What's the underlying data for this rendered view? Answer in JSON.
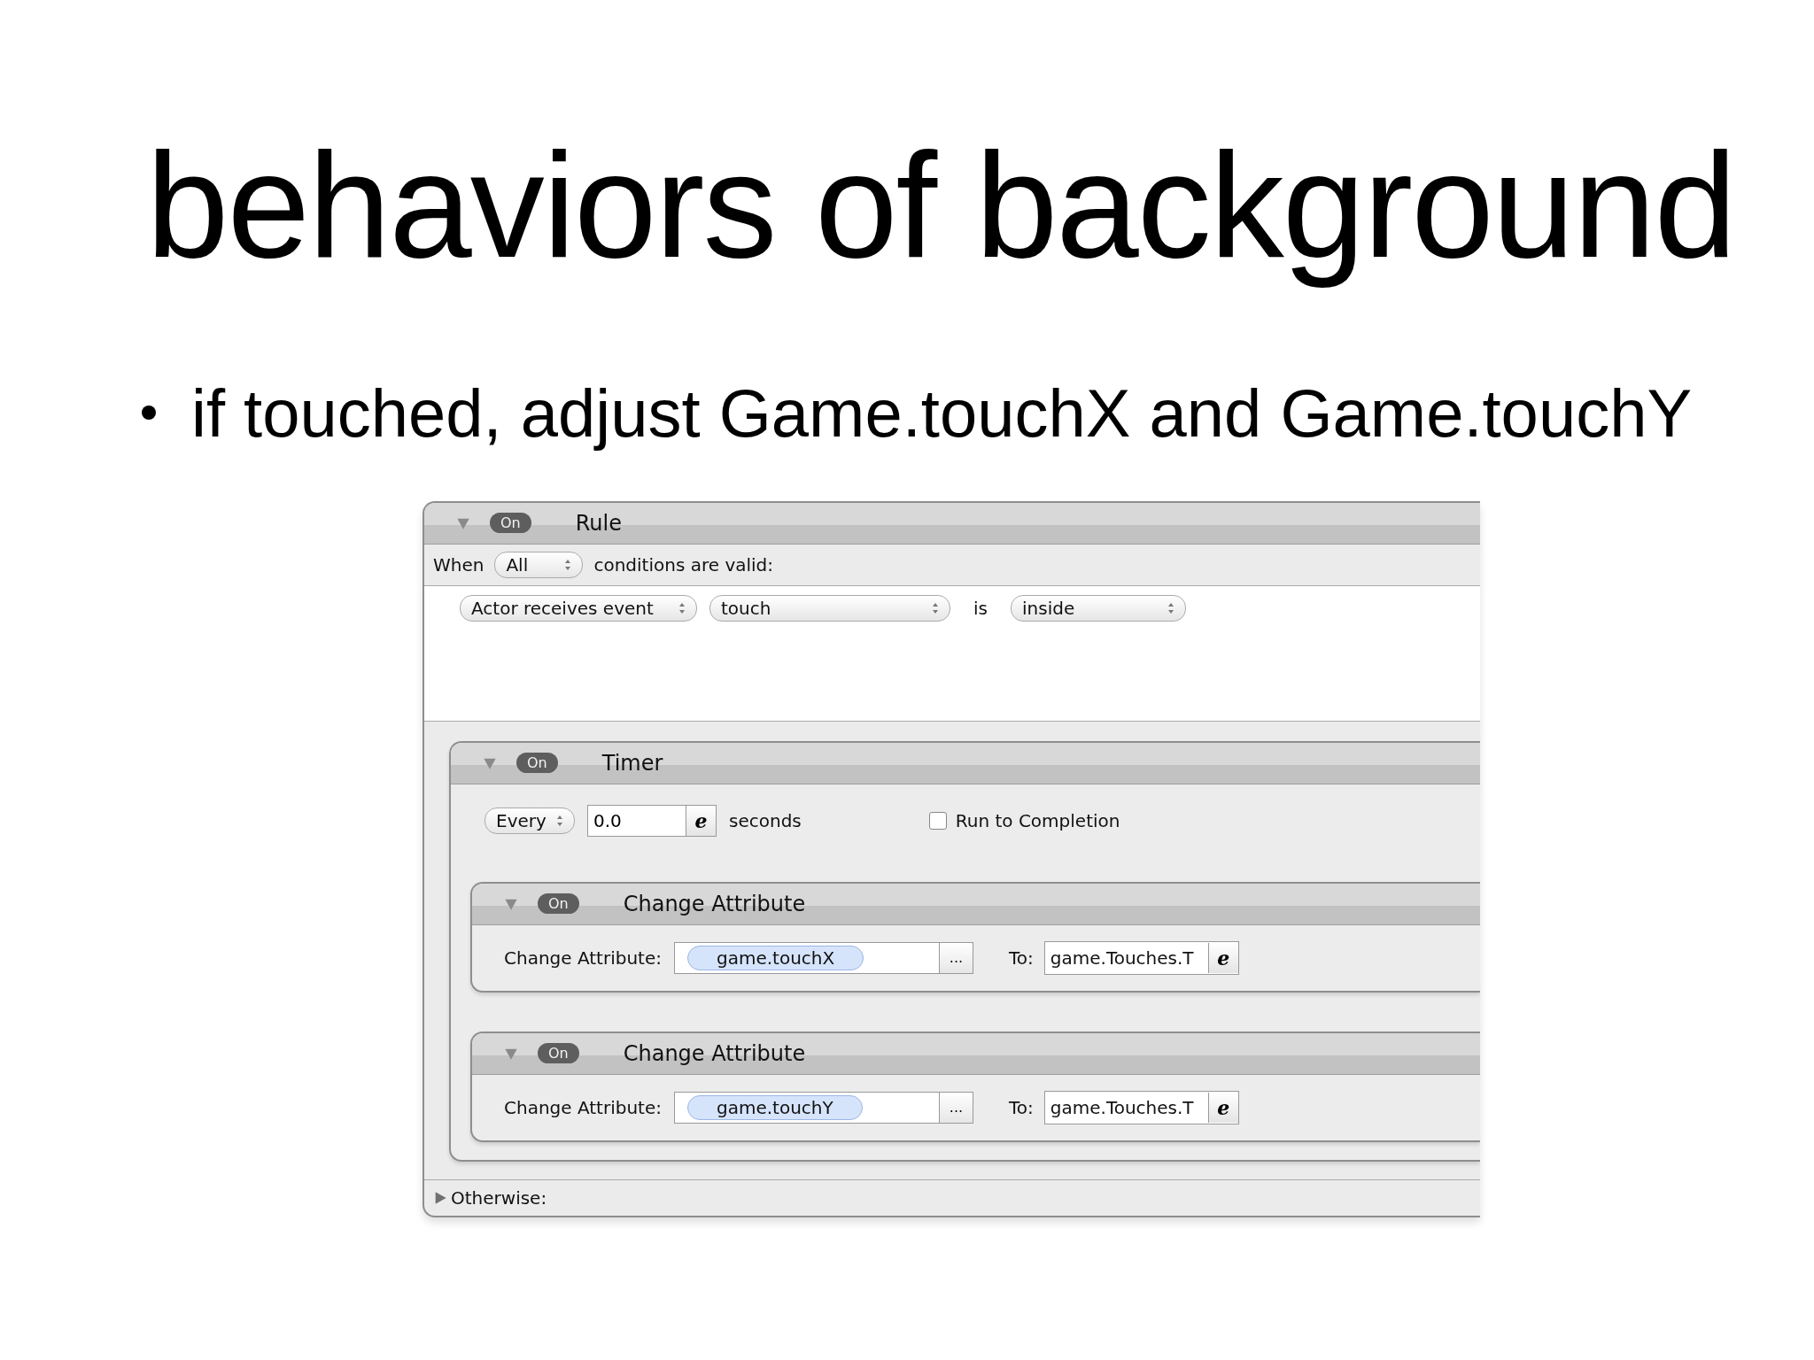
{
  "slide": {
    "title": "behaviors of background",
    "bullets": [
      "if touched, adjust Game.touchX and Game.touchY"
    ]
  },
  "rule": {
    "expanded": true,
    "toggle": "On",
    "title": "Rule",
    "when_label": "When",
    "match": "All",
    "conditions_suffix": "conditions are valid:",
    "conditions": [
      {
        "event": "Actor receives event",
        "type": "touch",
        "relation": "is",
        "value": "inside"
      }
    ],
    "timer": {
      "expanded": true,
      "toggle": "On",
      "title": "Timer",
      "mode": "Every",
      "interval": "0.0",
      "expr_button": "e",
      "unit": "seconds",
      "run_to_completion": {
        "label": "Run to Completion",
        "checked": false
      },
      "actions": [
        {
          "expanded": true,
          "toggle": "On",
          "title": "Change Attribute",
          "field_label": "Change Attribute:",
          "attribute": "game.touchX",
          "more": "...",
          "to_label": "To:",
          "to_value": "game.Touches.T",
          "expr_button": "e"
        },
        {
          "expanded": true,
          "toggle": "On",
          "title": "Change Attribute",
          "field_label": "Change Attribute:",
          "attribute": "game.touchY",
          "more": "...",
          "to_label": "To:",
          "to_value": "game.Touches.T",
          "expr_button": "e"
        }
      ]
    },
    "otherwise": {
      "label": "Otherwise:",
      "expanded": false
    }
  }
}
